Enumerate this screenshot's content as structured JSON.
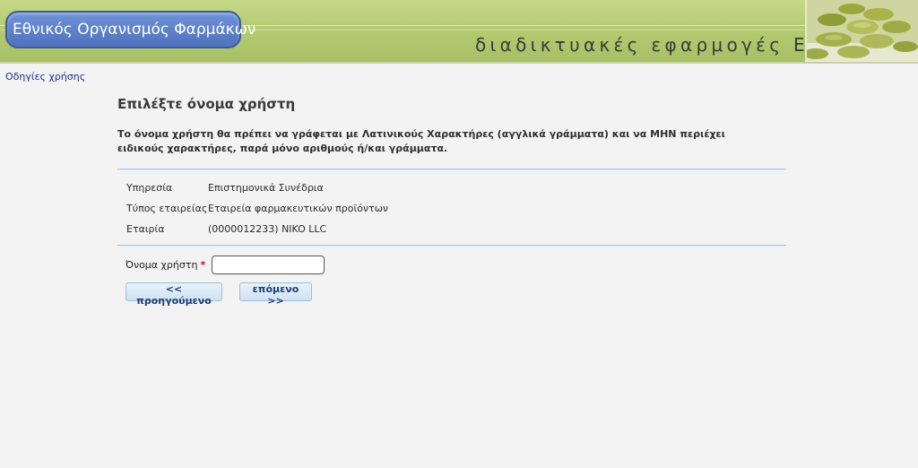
{
  "header": {
    "org_name": "Εθνικός Οργανισμός Φαρμάκων",
    "tagline": "διαδικτυακές εφαρμογές ΕΟΦ"
  },
  "help_link": "Οδηγίες χρήσης",
  "page": {
    "title": "Επιλέξτε όνομα χρήστη",
    "instructions": "Το όνομα χρήστη θα πρέπει να γράφεται με Λατινικούς Χαρακτήρες (αγγλικά γράμματα) και να ΜΗΝ περιέχει ειδικούς χαρακτήρες, παρά μόνο αριθμούς ή/και γράμματα."
  },
  "info": [
    {
      "label": "Υπηρεσία",
      "value": "Επιστημονικά Συνέδρια"
    },
    {
      "label": "Τύπος εταιρείας",
      "value": "Εταιρεία φαρμακευτικών προϊόντων"
    },
    {
      "label": "Εταιρία",
      "value": "(0000012233) NIKO LLC"
    }
  ],
  "form": {
    "username_label": "Όνομα χρήστη",
    "required_mark": "*",
    "username_value": ""
  },
  "buttons": {
    "prev_label": "<< προηγούμενο",
    "next_label": "επόμενο >>"
  },
  "colors": {
    "header_green": "#b4cb72",
    "logo_blue": "#5677c4",
    "link_blue": "#1c2f8a",
    "divider_blue": "#a9c4e0",
    "required_red": "#c8102e"
  }
}
